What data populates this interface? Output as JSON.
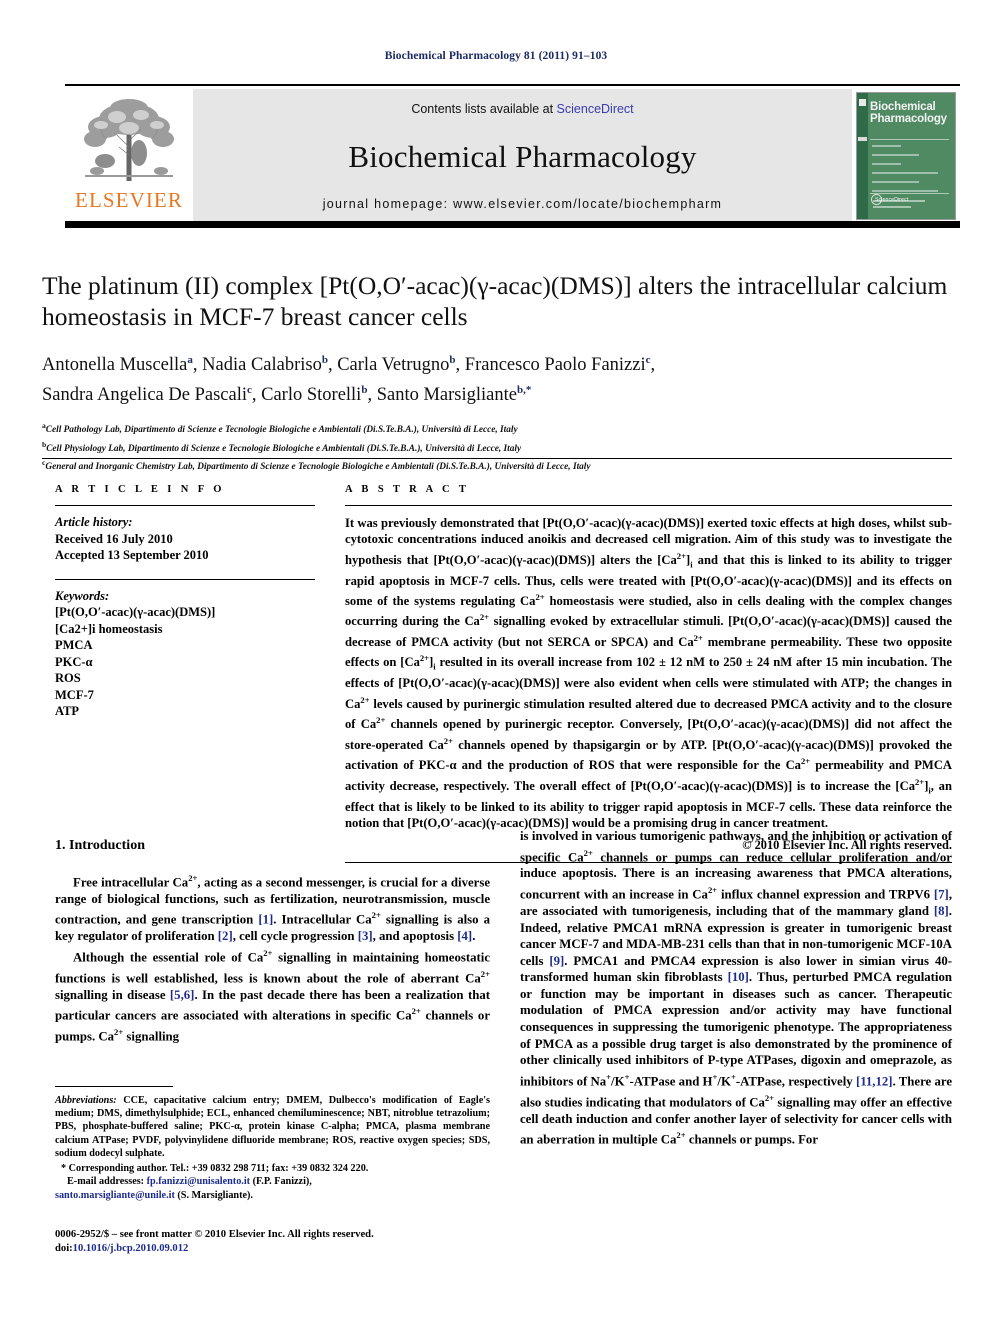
{
  "running_head": "Biochemical Pharmacology 81 (2011) 91–103",
  "masthead": {
    "contents_prefix": "Contents lists available at ",
    "sciencedirect": "ScienceDirect",
    "journal_title": "Biochemical Pharmacology",
    "homepage": "journal homepage: www.elsevier.com/locate/biochempharm",
    "publisher_logo_text": "ELSEVIER",
    "cover_title_line1": "Biochemical",
    "cover_title_line2": "Pharmacology",
    "cover_footer": "ScienceDirect",
    "accent_green": "#4f8a63",
    "accent_orange": "#e87722",
    "link_blue": "#3b3bb0"
  },
  "article": {
    "title": "The platinum (II) complex [Pt(O,O′-acac)(γ-acac)(DMS)] alters the intracellular calcium homeostasis in MCF-7 breast cancer cells",
    "authors_line1": "Antonella Muscella a, Nadia Calabriso b, Carla Vetrugno b, Francesco Paolo Fanizzi c,",
    "authors_line2": "Sandra Angelica De Pascali c, Carlo Storelli b, Santo Marsigliante b,*",
    "authors": [
      {
        "name": "Antonella Muscella",
        "sup": "a"
      },
      {
        "name": "Nadia Calabriso",
        "sup": "b"
      },
      {
        "name": "Carla Vetrugno",
        "sup": "b"
      },
      {
        "name": "Francesco Paolo Fanizzi",
        "sup": "c"
      },
      {
        "name": "Sandra Angelica De Pascali",
        "sup": "c"
      },
      {
        "name": "Carlo Storelli",
        "sup": "b"
      },
      {
        "name": "Santo Marsigliante",
        "sup": "b,*"
      }
    ],
    "affiliations": [
      {
        "marker": "a",
        "text": "Cell Pathology Lab, Dipartimento di Scienze e Tecnologie Biologiche e Ambientali (Di.S.Te.B.A.), Università di Lecce, Italy"
      },
      {
        "marker": "b",
        "text": "Cell Physiology Lab, Dipartimento di Scienze e Tecnologie Biologiche e Ambientali (Di.S.Te.B.A.), Università di Lecce, Italy"
      },
      {
        "marker": "c",
        "text": "General and Inorganic Chemistry Lab, Dipartimento di Scienze e Tecnologie Biologiche e Ambientali (Di.S.Te.B.A.), Università di Lecce, Italy"
      }
    ]
  },
  "article_info": {
    "heading": "A R T I C L E  I N F O",
    "history_label": "Article history:",
    "received": "Received 16 July 2010",
    "accepted": "Accepted 13 September 2010",
    "keywords_label": "Keywords:",
    "keywords": [
      "[Pt(O,O′-acac)(γ-acac)(DMS)]",
      "[Ca2+]i homeostasis",
      "PMCA",
      "PKC-α",
      "ROS",
      "MCF-7",
      "ATP"
    ]
  },
  "abstract": {
    "heading": "A B S T R A C T",
    "text": "It was previously demonstrated that [Pt(O,O′-acac)(γ-acac)(DMS)] exerted toxic effects at high doses, whilst sub-cytotoxic concentrations induced anoikis and decreased cell migration. Aim of this study was to investigate the hypothesis that [Pt(O,O′-acac)(γ-acac)(DMS)] alters the [Ca2+]i and that this is linked to its ability to trigger rapid apoptosis in MCF-7 cells. Thus, cells were treated with [Pt(O,O′-acac)(γ-acac)(DMS)] and its effects on some of the systems regulating Ca2+ homeostasis were studied, also in cells dealing with the complex changes occurring during the Ca2+ signalling evoked by extracellular stimuli. [Pt(O,O′-acac)(γ-acac)(DMS)] caused the decrease of PMCA activity (but not SERCA or SPCA) and Ca2+ membrane permeability. These two opposite effects on [Ca2+]i resulted in its overall increase from 102 ± 12 nM to 250 ± 24 nM after 15 min incubation. The effects of [Pt(O,O′-acac)(γ-acac)(DMS)] were also evident when cells were stimulated with ATP; the changes in Ca2+ levels caused by purinergic stimulation resulted altered due to decreased PMCA activity and to the closure of Ca2+ channels opened by purinergic receptor. Conversely, [Pt(O,O′-acac)(γ-acac)(DMS)] did not affect the store-operated Ca2+ channels opened by thapsigargin or by ATP. [Pt(O,O′-acac)(γ-acac)(DMS)] provoked the activation of PKC-α and the production of ROS that were responsible for the Ca2+ permeability and PMCA activity decrease, respectively. The overall effect of [Pt(O,O′-acac)(γ-acac)(DMS)] is to increase the [Ca2+]i, an effect that is likely to be linked to its ability to trigger rapid apoptosis in MCF-7 cells. These data reinforce the notion that [Pt(O,O′-acac)(γ-acac)(DMS)] would be a promising drug in cancer treatment.",
    "copyright": "© 2010 Elsevier Inc. All rights reserved."
  },
  "introduction": {
    "heading": "1. Introduction",
    "para1": "Free intracellular Ca2+, acting as a second messenger, is crucial for a diverse range of biological functions, such as fertilization, neurotransmission, muscle contraction, and gene transcription [1]. Intracellular Ca2+ signalling is also a key regulator of proliferation [2], cell cycle progression [3], and apoptosis [4].",
    "para2": "Although the essential role of Ca2+ signalling in maintaining homeostatic functions is well established, less is known about the role of aberrant Ca2+ signalling in disease [5,6]. In the past decade there has been a realization that particular cancers are associated with alterations in specific Ca2+ channels or pumps. Ca2+ signalling",
    "para_right1": "is involved in various tumorigenic pathways, and the inhibition or activation of specific Ca2+ channels or pumps can reduce cellular proliferation and/or induce apoptosis. There is an increasing awareness that PMCA alterations, concurrent with an increase in Ca2+ influx channel expression and TRPV6 [7], are associated with tumorigenesis, including that of the mammary gland [8]. Indeed, relative PMCA1 mRNA expression is greater in tumorigenic breast cancer MCF-7 and MDA-MB-231 cells than that in non-tumorigenic MCF-10A cells [9]. PMCA1 and PMCA4 expression is also lower in simian virus 40-transformed human skin fibroblasts [10]. Thus, perturbed PMCA regulation or function may be important in diseases such as cancer. Therapeutic modulation of PMCA expression and/or activity may have functional consequences in suppressing the tumorigenic phenotype. The appropriateness of PMCA as a possible drug target is also demonstrated by the prominence of other clinically used inhibitors of P-type ATPases, digoxin and omeprazole, as inhibitors of Na+/K+-ATPase and H+/K+-ATPase, respectively [11,12]. There are also studies indicating that modulators of Ca2+ signalling may offer an effective cell death induction and confer another layer of selectivity for cancer cells with an aberration in multiple Ca2+ channels or pumps. For"
  },
  "footnotes": {
    "abbrev_label": "Abbreviations:",
    "abbrev_text": "CCE, capacitative calcium entry; DMEM, Dulbecco's modification of Eagle's medium; DMS, dimethylsulphide; ECL, enhanced chemiluminescence; NBT, nitroblue tetrazolium; PBS, phosphate-buffered saline; PKC-α, protein kinase C-alpha; PMCA, plasma membrane calcium ATPase; PVDF, polyvinylidene difluoride membrane; ROS, reactive oxygen species; SDS, sodium dodecyl sulphate.",
    "corresponding": "Corresponding author. Tel.: +39 0832 298 711; fax: +39 0832 324 220.",
    "email_label": "E-mail addresses:",
    "email1": "fp.fanizzi@unisalento.it",
    "email1_owner": "(F.P. Fanizzi),",
    "email2": "santo.marsigliante@unile.it",
    "email2_owner": "(S. Marsigliante).",
    "issn_line": "0006-2952/$ – see front matter © 2010 Elsevier Inc. All rights reserved.",
    "doi_label": "doi:",
    "doi_value": "10.1016/j.bcp.2010.09.012"
  }
}
